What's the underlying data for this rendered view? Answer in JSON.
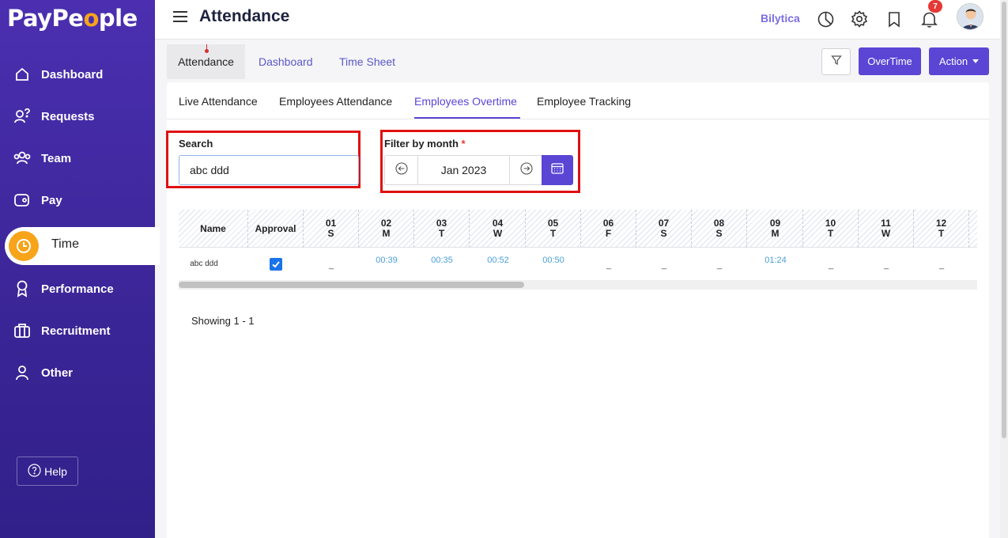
{
  "app": {
    "logo_pre": "PayPe",
    "logo_o": "o",
    "logo_post": "ple"
  },
  "sidebar": {
    "items": [
      {
        "label": "Dashboard",
        "icon": "home-icon"
      },
      {
        "label": "Requests",
        "icon": "requests-icon"
      },
      {
        "label": "Team",
        "icon": "team-icon"
      },
      {
        "label": "Pay",
        "icon": "pay-icon"
      },
      {
        "label": "Time",
        "icon": "clock-icon",
        "active": true
      },
      {
        "label": "Performance",
        "icon": "award-icon"
      },
      {
        "label": "Recruitment",
        "icon": "briefcase-icon"
      },
      {
        "label": "Other",
        "icon": "user-icon"
      }
    ],
    "help_label": "Help"
  },
  "header": {
    "title": "Attendance",
    "company": "Bilytica",
    "notification_count": "7"
  },
  "top_tabs": [
    {
      "label": "Attendance",
      "active": true
    },
    {
      "label": "Dashboard"
    },
    {
      "label": "Time Sheet"
    }
  ],
  "toolbar": {
    "overtime_label": "OverTime",
    "action_label": "Action"
  },
  "sub_tabs": [
    {
      "label": "Live Attendance"
    },
    {
      "label": "Employees Attendance"
    },
    {
      "label": "Employees Overtime",
      "active": true
    },
    {
      "label": "Employee Tracking"
    }
  ],
  "filters": {
    "search_label": "Search",
    "search_value": "abc ddd",
    "month_label": "Filter by month",
    "month_required_mark": "*",
    "month_value": "Jan 2023"
  },
  "table": {
    "name_header": "Name",
    "approval_header": "Approval",
    "days": [
      {
        "d": "01",
        "w": "S"
      },
      {
        "d": "02",
        "w": "M"
      },
      {
        "d": "03",
        "w": "T"
      },
      {
        "d": "04",
        "w": "W"
      },
      {
        "d": "05",
        "w": "T"
      },
      {
        "d": "06",
        "w": "F"
      },
      {
        "d": "07",
        "w": "S"
      },
      {
        "d": "08",
        "w": "S"
      },
      {
        "d": "09",
        "w": "M"
      },
      {
        "d": "10",
        "w": "T"
      },
      {
        "d": "11",
        "w": "W"
      },
      {
        "d": "12",
        "w": "T"
      }
    ],
    "rows": [
      {
        "name": "abc ddd",
        "approved": true,
        "values": [
          "_",
          "00:39",
          "00:35",
          "00:52",
          "00:50",
          "_",
          "_",
          "_",
          "01:24",
          "_",
          "_",
          "_"
        ]
      }
    ]
  },
  "pagination": {
    "showing": "Showing 1 - 1"
  },
  "colors": {
    "sidebar": "#3a2596",
    "accent": "#5a45d4",
    "highlight": "#e01010",
    "time_value": "#4a9fd8",
    "logo_o": "#f7a41a"
  }
}
